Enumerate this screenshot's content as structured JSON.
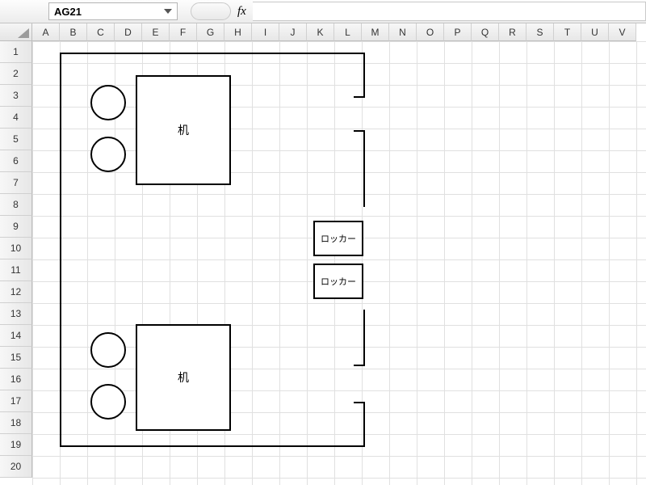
{
  "formula_bar": {
    "name_box_value": "AG21",
    "fx_label": "fx",
    "formula_value": ""
  },
  "columns": [
    "A",
    "B",
    "C",
    "D",
    "E",
    "F",
    "G",
    "H",
    "I",
    "J",
    "K",
    "L",
    "M",
    "N",
    "O",
    "P",
    "Q",
    "R",
    "S",
    "T",
    "U",
    "V"
  ],
  "rows": [
    "1",
    "2",
    "3",
    "4",
    "5",
    "6",
    "7",
    "8",
    "9",
    "10",
    "11",
    "12",
    "13",
    "14",
    "15",
    "16",
    "17",
    "18",
    "19",
    "20"
  ],
  "shapes": {
    "desk1_label": "机",
    "desk2_label": "机",
    "locker1_label": "ロッカー",
    "locker2_label": "ロッカー"
  }
}
